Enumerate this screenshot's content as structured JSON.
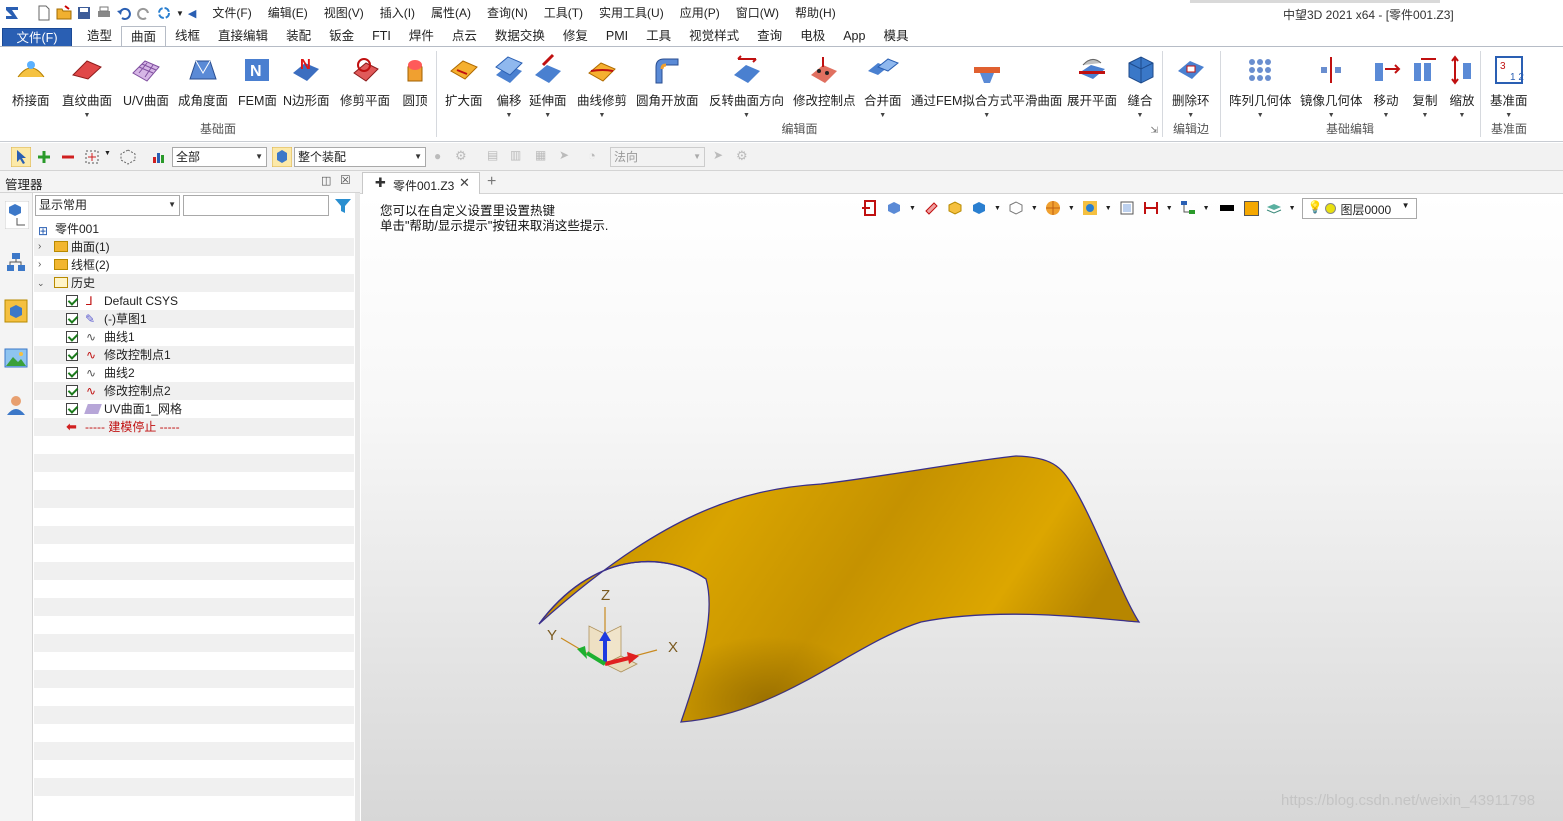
{
  "title_bar": {
    "window_title": "中望3D 2021 x64 - [零件001.Z3]",
    "menus": [
      "文件(F)",
      "编辑(E)",
      "视图(V)",
      "插入(I)",
      "属性(A)",
      "查询(N)",
      "工具(T)",
      "实用工具(U)",
      "应用(P)",
      "窗口(W)",
      "帮助(H)"
    ]
  },
  "ribbon_tabs": {
    "file": "文件(F)",
    "tabs": [
      "造型",
      "曲面",
      "线框",
      "直接编辑",
      "装配",
      "钣金",
      "FTI",
      "焊件",
      "点云",
      "数据交换",
      "修复",
      "PMI",
      "工具",
      "视觉样式",
      "查询",
      "电极",
      "App",
      "模具"
    ],
    "active": "曲面"
  },
  "ribbon": {
    "groups": {
      "base_surface": "基础面",
      "edit_surface": "编辑面",
      "edit_edge": "编辑边",
      "base_edit": "基础编辑",
      "datum": "基准面"
    },
    "buttons": {
      "bridge": "桥接面",
      "ruled": "直纹曲面",
      "uv": "U/V曲面",
      "draft": "成角度面",
      "fem": "FEM面",
      "nside": "N边形面",
      "trim_plane": "修剪平面",
      "dome": "圆顶",
      "extend": "扩大面",
      "offset": "偏移",
      "stretch": "延伸面",
      "curve_trim": "曲线修剪",
      "fillet_open": "圆角开放面",
      "reverse": "反转曲面方向",
      "modify_cp": "修改控制点",
      "merge": "合并面",
      "fem_fit": "通过FEM拟合方式平滑曲面",
      "unfold": "展开平面",
      "sew": "缝合",
      "delete_loop": "删除环",
      "pattern": "阵列几何体",
      "mirror": "镜像几何体",
      "move": "移动",
      "copy": "复制",
      "scale": "缩放",
      "datum_plane": "基准面"
    }
  },
  "toolbar": {
    "filter": "全部",
    "assembly": "整个装配",
    "direction": "法向"
  },
  "manager": {
    "title": "管理器",
    "display_filter": "显示常用",
    "root": "零件001",
    "items": [
      {
        "label": "曲面(1)",
        "type": "folder"
      },
      {
        "label": "线框(2)",
        "type": "folder"
      },
      {
        "label": "历史",
        "type": "folder-open"
      },
      {
        "label": "Default CSYS",
        "type": "history"
      },
      {
        "label": "(-)草图1",
        "type": "history"
      },
      {
        "label": "曲线1",
        "type": "history"
      },
      {
        "label": "修改控制点1",
        "type": "history"
      },
      {
        "label": "曲线2",
        "type": "history"
      },
      {
        "label": "修改控制点2",
        "type": "history"
      },
      {
        "label": "UV曲面1_网格",
        "type": "history"
      }
    ],
    "stop_marker": "----- 建模停止 -----"
  },
  "document": {
    "tab": "零件001.Z3",
    "hint_line1": "您可以在自定义设置里设置热键",
    "hint_line2": "单击\"帮助/显示提示\"按钮来取消这些提示.",
    "layer": "图层0000",
    "axes": {
      "x": "X",
      "y": "Y",
      "z": "Z"
    },
    "surface_color": "#d4a000"
  },
  "watermark": "https://blog.csdn.net/weixin_43911798"
}
